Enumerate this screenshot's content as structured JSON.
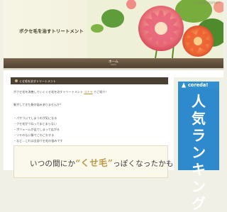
{
  "header": {
    "top_note": "クセ毛改善の方法を紹介",
    "site_title": "ボクセ毛を治すトリートメント"
  },
  "nav": {
    "items": [
      {
        "label": "ホーム",
        "sub": "home"
      }
    ]
  },
  "post": {
    "title": "くせ毛を治すトリートメント",
    "lines": [
      {
        "text": "ボクセ毛を改善していくくせ毛を治すトリートメント",
        "link": "コチラ",
        "suffix": "でご紹介！"
      },
      {
        "text": "髪がしてきた髪の悩みありませんか？"
      },
      {
        "text": "・パサついてしまうのが気になる"
      },
      {
        "text": "・クセ毛がうねってまとまらない"
      },
      {
        "text": "・ボリュームが出てしまって広がる"
      },
      {
        "text": "・ツヤのない髪でごわごわする"
      },
      {
        "text": "・など…これは全部クセ毛の悩みです"
      }
    ],
    "banner": {
      "pre": "いつの間にか",
      "hl": "“くせ毛”",
      "post": "っぽくなったかも？"
    }
  },
  "sidebar": {
    "logo": "coreda!",
    "ranking": "人気ランキング"
  },
  "colors": {
    "nav_bg": "#5a4836",
    "accent_blue": "#2e8acc",
    "link": "#b8923a"
  }
}
